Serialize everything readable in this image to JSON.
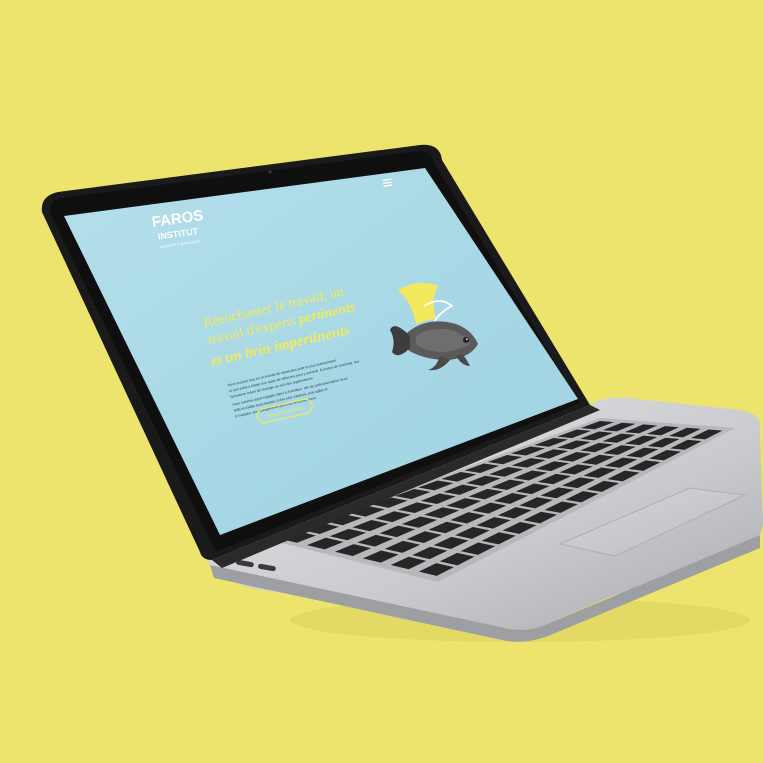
{
  "colors": {
    "background": "#ece46c",
    "screen_bg": "#a9d8e5",
    "accent_yellow": "#f2ea5c",
    "laptop_body": "#cfd0d2",
    "bezel": "#151515",
    "keys": "#262626"
  },
  "site": {
    "logo_main": "FAROS",
    "logo_sub": "INSTITUT",
    "logo_tagline": "LEADERS & MANAGERS",
    "menu_icon": "hamburger-icon",
    "headline_line1": "Réenchanter le travail, un",
    "headline_line2_plain": "travail d'experts",
    "headline_line2_script": "pertinents",
    "headline_line3_script": "et un brin impertinents",
    "body_lines": [
      "Nous croyons tous en un monde du travail plus juste et plus épanouissant",
      "et sont prêts à élargir leur cadre de référence pour y parvenir. À propos de coaching, nos",
      "formations créent de l'énergie au sein des organisations.",
      "Nous sommes aussi engagés dans la formation, afin de professionnaliser leurs",
      "skills et d'aider leurs équipes à être plus créatives, plus agiles et",
      "à s'adapter aux changements dans leur environnement."
    ],
    "cta_label": "Découvrez Faros",
    "hero_image": "goldfish-with-shark-fin-illustration"
  }
}
